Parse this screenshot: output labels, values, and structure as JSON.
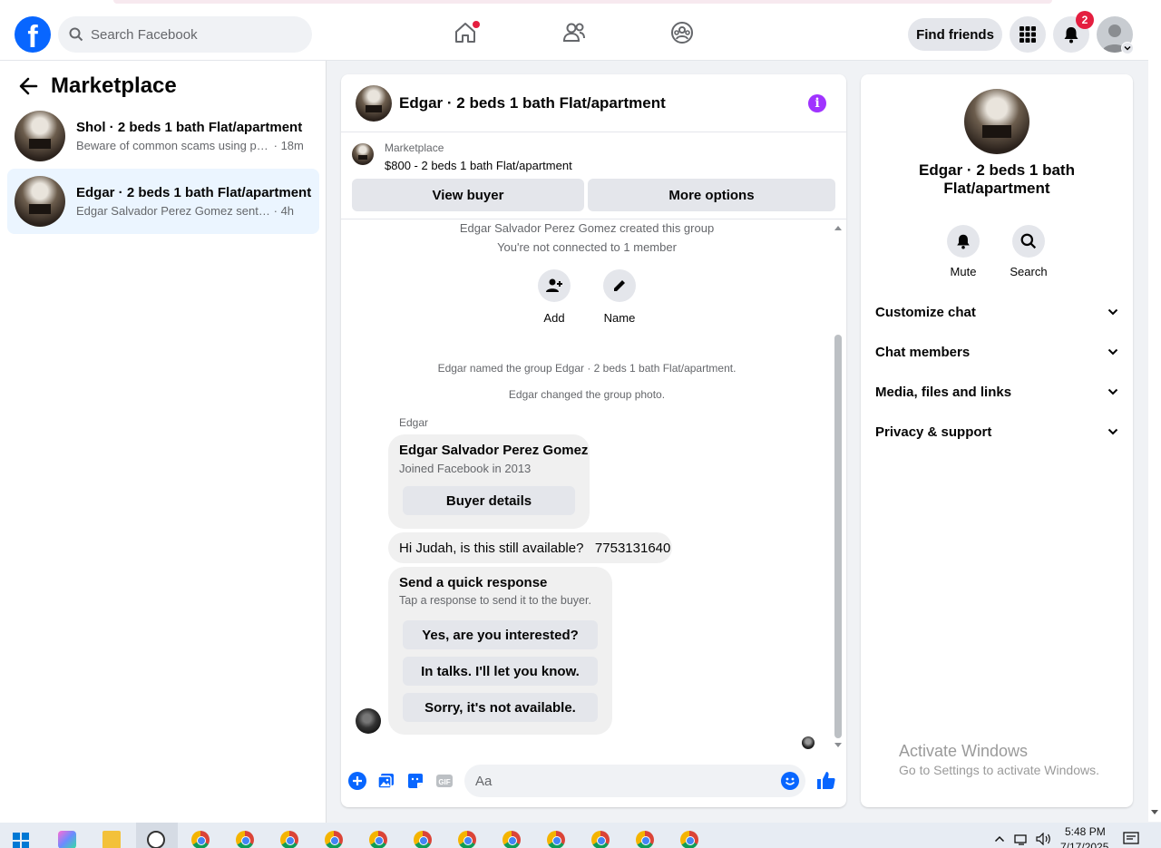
{
  "topbar": {
    "logo_glyph": "f",
    "search_placeholder": "Search Facebook",
    "find_friends": "Find friends",
    "notification_count": "2"
  },
  "sidebar": {
    "title": "Marketplace",
    "conversations": [
      {
        "title": "Shol · 2 beds 1 bath Flat/apartment",
        "preview": "Beware of common scams using pa...",
        "time": "· 18m",
        "active": false
      },
      {
        "title": "Edgar · 2 beds 1 bath Flat/apartment",
        "preview": "Edgar Salvador Perez Gomez sent you...",
        "time": "· 4h",
        "active": true
      }
    ]
  },
  "chat": {
    "title": "Edgar · 2 beds 1 bath Flat/apartment",
    "listing_source": "Marketplace",
    "listing_price": "$800 - 2 beds 1 bath Flat/apartment",
    "view_buyer": "View buyer",
    "more_options": "More options",
    "system_created": "Edgar Salvador Perez Gomez created this group",
    "system_not_connected": "You're not connected to 1 member",
    "action_add": "Add",
    "action_name": "Name",
    "system_named": "Edgar named the group Edgar · 2 beds 1 bath Flat/apartment.",
    "system_photo": "Edgar changed the group photo.",
    "sender": "Edgar",
    "profile_name": "Edgar Salvador Perez Gomez",
    "profile_joined": "Joined Facebook in 2013",
    "buyer_details": "Buyer details",
    "message_text": "Hi Judah, is this still available?   7753131640",
    "quick_title": "Send a quick response",
    "quick_sub": "Tap a response to send it to the buyer.",
    "quick_responses": [
      "Yes, are you interested?",
      "In talks. I'll let you know.",
      "Sorry, it's not available."
    ],
    "composer_placeholder": "Aa"
  },
  "details": {
    "title": "Edgar · 2 beds 1 bath Flat/apartment",
    "mute": "Mute",
    "search": "Search",
    "sections": [
      "Customize chat",
      "Chat members",
      "Media, files and links",
      "Privacy & support"
    ]
  },
  "watermark": {
    "line1": "Activate Windows",
    "line2": "Go to Settings to activate Windows."
  },
  "taskbar": {
    "time": "5:48 PM",
    "date": "7/17/2025"
  },
  "colors": {
    "brand": "#0866ff",
    "info_accent": "#a033ff",
    "badge": "#e41e3f",
    "active_conversation_bg": "#ebf5ff"
  }
}
